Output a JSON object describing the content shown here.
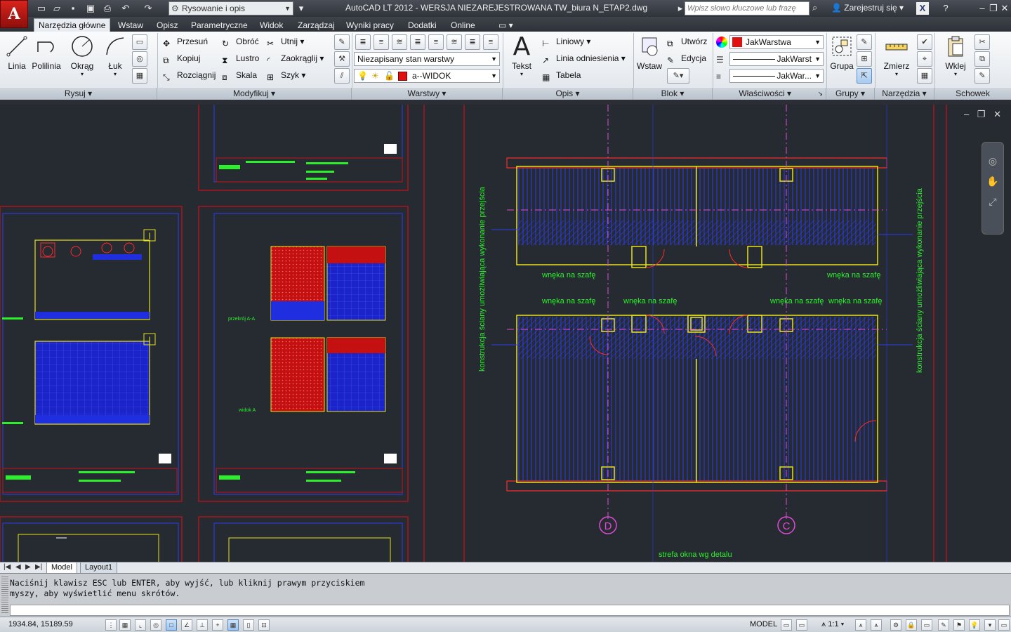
{
  "titlebar": {
    "app_button": "A",
    "workspace": "Rysowanie i opis",
    "title": "AutoCAD LT 2012 - WERSJA NIEZAREJESTROWANA    TW_biura N_ETAP2.dwg",
    "search_placeholder": "Wpisz słowo kluczowe lub frazę",
    "signin": "Zarejestruj się"
  },
  "ribbon_tabs": [
    "Narzędzia główne",
    "Wstaw",
    "Opisz",
    "Parametryczne",
    "Widok",
    "Zarządzaj",
    "Wyniki pracy",
    "Dodatki",
    "Online"
  ],
  "panels": {
    "rysuj": {
      "title": "Rysuj",
      "linia": "Linia",
      "polilinia": "Polilinia",
      "okrag": "Okrąg",
      "luk": "Łuk"
    },
    "modyfikuj": {
      "title": "Modyfikuj",
      "przesun": "Przesuń",
      "obroc": "Obróć",
      "utnij": "Utnij",
      "kopiuj": "Kopiuj",
      "lustro": "Lustro",
      "zaokraglij": "Zaokrąglij",
      "rozciagnij": "Rozciągnij",
      "skala": "Skala",
      "szyk": "Szyk"
    },
    "warstwy": {
      "title": "Warstwy",
      "state": "Niezapisany stan warstwy",
      "layer": "a--WIDOK"
    },
    "opis": {
      "title": "Opis",
      "tekst": "Tekst",
      "liniowy": "Liniowy",
      "odniesienie": "Linia odniesienia",
      "tabela": "Tabela"
    },
    "blok": {
      "title": "Blok",
      "wstaw": "Wstaw",
      "utworz": "Utwórz",
      "edycja": "Edycja"
    },
    "wlasciwosci": {
      "title": "Właściwości",
      "color": "JakWarstwa",
      "linetype": "JakWarst",
      "lineweight": "JakWar..."
    },
    "grupy": {
      "title": "Grupy",
      "grupa": "Grupa"
    },
    "narzedzia": {
      "title": "Narzędzia",
      "zmierz": "Zmierz"
    },
    "schowek": {
      "title": "Schowek",
      "wklej": "Wklej"
    }
  },
  "drawing": {
    "labels": {
      "wneka": "wnęka na szafę",
      "konstrukcja": "konstrukcja ściany umożliwiająca wykonanie przejścia",
      "strefa": "strefa okna wg detalu",
      "axis_d": "D",
      "axis_c": "C",
      "przekroj": "przekrój A-A",
      "widok": "widok A",
      "marker_i": "I"
    },
    "colors": {
      "frame": "#c8101a",
      "wall": "#e8e31c",
      "hatch": "#1f2fe0",
      "text": "#2cf02c",
      "axis": "#e04ad6",
      "dim": "#ff2a2a",
      "white": "#ffffff",
      "red_fill": "#d41616"
    }
  },
  "layout_tabs": [
    "Model",
    "Layout1"
  ],
  "command": {
    "line1": "Naciśnij klawisz ESC lub ENTER, aby wyjść, lub kliknij prawym przyciskiem",
    "line2": "myszy, aby wyświetlić menu skrótów."
  },
  "status": {
    "coords": "1934.84, 15189.59",
    "model": "MODEL",
    "scale": "1:1"
  }
}
